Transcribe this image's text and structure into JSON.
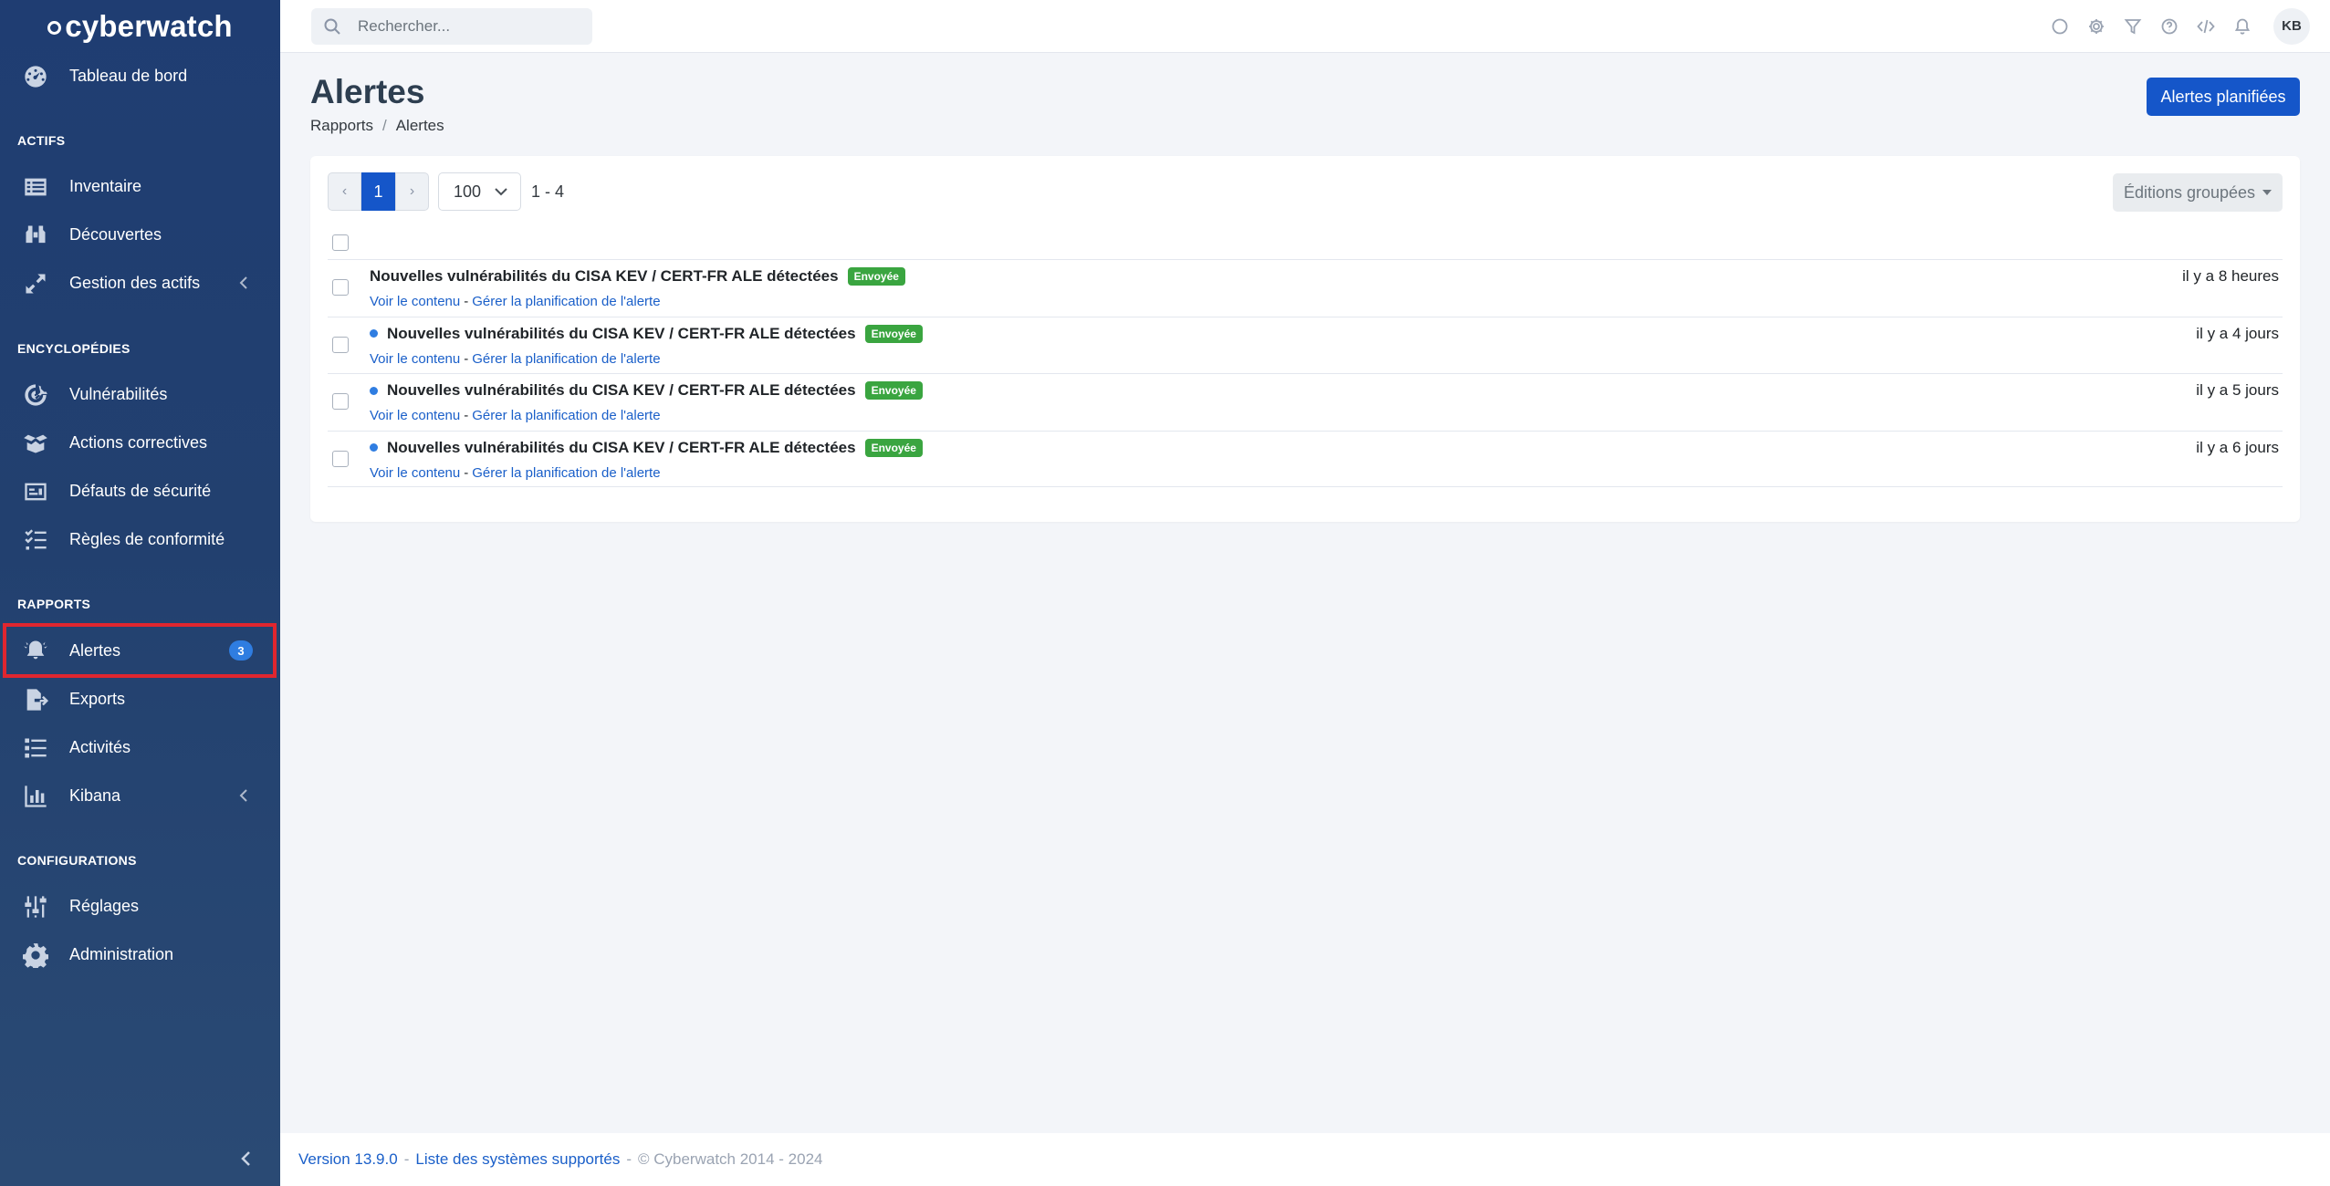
{
  "brand": {
    "name": "cyberwatch"
  },
  "search": {
    "placeholder": "Rechercher..."
  },
  "topbar": {
    "icons": [
      "circle-icon",
      "gear-icon",
      "filter-icon",
      "help-icon",
      "code-icon",
      "bell-icon"
    ],
    "avatar_initials": "KB"
  },
  "sidebar": {
    "dashboard": "Tableau de bord",
    "sections": {
      "actifs": "ACTIFS",
      "encyclopedies": "ENCYCLOPÉDIES",
      "rapports": "RAPPORTS",
      "configurations": "CONFIGURATIONS"
    },
    "items": {
      "inventaire": "Inventaire",
      "decouvertes": "Découvertes",
      "gestion_actifs": "Gestion des actifs",
      "vulnerabilites": "Vulnérabilités",
      "actions_correctives": "Actions correctives",
      "defauts_securite": "Défauts de sécurité",
      "regles_conformite": "Règles de conformité",
      "alertes": "Alertes",
      "alertes_badge": "3",
      "exports": "Exports",
      "activites": "Activités",
      "kibana": "Kibana",
      "reglages": "Réglages",
      "administration": "Administration"
    }
  },
  "header": {
    "title": "Alertes",
    "breadcrumb": [
      "Rapports",
      "Alertes"
    ],
    "breadcrumb_separator": "/",
    "primary_button": "Alertes planifiées"
  },
  "toolbar": {
    "prev": "‹",
    "current_page": "1",
    "next": "›",
    "per_page": "100",
    "range": "1 - 4",
    "bulk_actions": "Éditions groupées"
  },
  "alerts": [
    {
      "title": "Nouvelles vulnérabilités du CISA KEV / CERT-FR ALE détectées",
      "status": "Envoyée",
      "unread": false,
      "time": "il y a 8 heures",
      "link_view": "Voir le contenu",
      "link_manage": "Gérer la planification de l'alerte"
    },
    {
      "title": "Nouvelles vulnérabilités du CISA KEV / CERT-FR ALE détectées",
      "status": "Envoyée",
      "unread": true,
      "time": "il y a 4 jours",
      "link_view": "Voir le contenu",
      "link_manage": "Gérer la planification de l'alerte"
    },
    {
      "title": "Nouvelles vulnérabilités du CISA KEV / CERT-FR ALE détectées",
      "status": "Envoyée",
      "unread": true,
      "time": "il y a 5 jours",
      "link_view": "Voir le contenu",
      "link_manage": "Gérer la planification de l'alerte"
    },
    {
      "title": "Nouvelles vulnérabilités du CISA KEV / CERT-FR ALE détectées",
      "status": "Envoyée",
      "unread": true,
      "time": "il y a 6 jours",
      "link_view": "Voir le contenu",
      "link_manage": "Gérer la planification de l'alerte"
    }
  ],
  "footer": {
    "version": "Version 13.9.0",
    "dash": "-",
    "supported": "Liste des systèmes supportés",
    "copyright": "© Cyberwatch 2014 - 2024"
  },
  "colors": {
    "sidebar_bg": "#1f3d72",
    "primary": "#1556c9",
    "status_sent": "#3aa540",
    "unread_dot": "#2f7de1",
    "active_outline": "#e0262f"
  }
}
